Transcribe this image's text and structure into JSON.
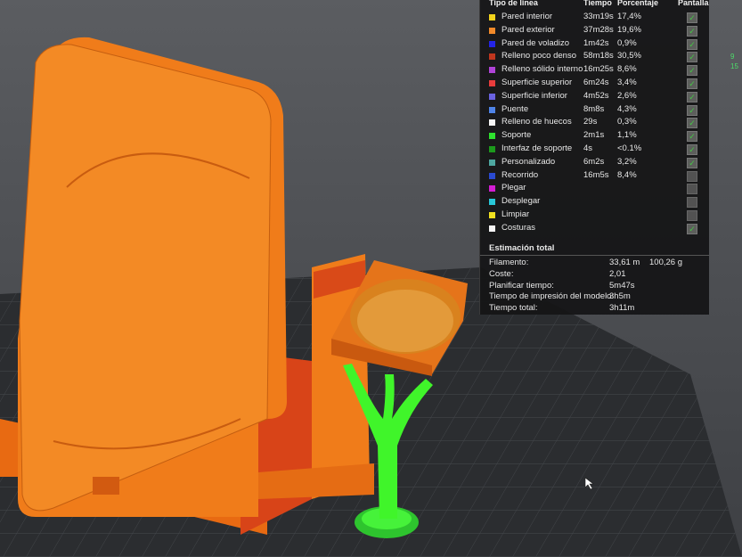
{
  "legend": {
    "headers": {
      "type": "Tipo de línea",
      "time": "Tiempo",
      "percent": "Porcentaje",
      "display": "Pantalla"
    },
    "items": [
      {
        "label": "Pared interior",
        "time": "33m19s",
        "percent": "17,4%",
        "color": "#f2d31c",
        "visible": true
      },
      {
        "label": "Pared exterior",
        "time": "37m28s",
        "percent": "19,6%",
        "color": "#f28a2a",
        "visible": true
      },
      {
        "label": "Pared de voladizo",
        "time": "1m42s",
        "percent": "0,9%",
        "color": "#2424e6",
        "visible": true
      },
      {
        "label": "Relleno poco denso",
        "time": "58m18s",
        "percent": "30,5%",
        "color": "#c0361e",
        "visible": true
      },
      {
        "label": "Relleno sólido interno",
        "time": "16m25s",
        "percent": "8,6%",
        "color": "#b043d8",
        "visible": true
      },
      {
        "label": "Superficie superior",
        "time": "6m24s",
        "percent": "3,4%",
        "color": "#e83c3c",
        "visible": true
      },
      {
        "label": "Superficie inferior",
        "time": "4m52s",
        "percent": "2,6%",
        "color": "#6a62e0",
        "visible": true
      },
      {
        "label": "Puente",
        "time": "8m8s",
        "percent": "4,3%",
        "color": "#4f84e8",
        "visible": true
      },
      {
        "label": "Relleno de huecos",
        "time": "29s",
        "percent": "0,3%",
        "color": "#f5f5f5",
        "visible": true
      },
      {
        "label": "Soporte",
        "time": "2m1s",
        "percent": "1,1%",
        "color": "#2ee02e",
        "visible": true
      },
      {
        "label": "Interfaz de soporte",
        "time": "4s",
        "percent": "<0.1%",
        "color": "#1c9a1c",
        "visible": true
      },
      {
        "label": "Personalizado",
        "time": "6m2s",
        "percent": "3,2%",
        "color": "#4ea7a0",
        "visible": true
      },
      {
        "label": "Recorrido",
        "time": "16m5s",
        "percent": "8,4%",
        "color": "#2a4ad0",
        "visible": false
      },
      {
        "label": "Plegar",
        "time": "",
        "percent": "",
        "color": "#d41ed4",
        "visible": false
      },
      {
        "label": "Desplegar",
        "time": "",
        "percent": "",
        "color": "#28c8d8",
        "visible": false
      },
      {
        "label": "Limpiar",
        "time": "",
        "percent": "",
        "color": "#f0e020",
        "visible": false
      },
      {
        "label": "Costuras",
        "time": "",
        "percent": "",
        "color": "#f5f5f5",
        "visible": true
      }
    ]
  },
  "estimate": {
    "title": "Estimación total",
    "rows": [
      {
        "key": "Filamento:",
        "value": "33,61 m",
        "value2": "100,26 g"
      },
      {
        "key": "Coste:",
        "value": "2,01",
        "value2": ""
      },
      {
        "key": "Planificar tiempo:",
        "value": "5m47s",
        "value2": ""
      },
      {
        "key": "Tiempo de impresión del modelo:",
        "value": "3h5m",
        "value2": ""
      },
      {
        "key": "Tiempo total:",
        "value": "3h11m",
        "value2": ""
      }
    ]
  },
  "edge_text": [
    "9",
    "15"
  ],
  "colors": {
    "model": "#f07c1a",
    "support": "#40f52a",
    "plate": "#2f3134",
    "infill": "#d84418"
  }
}
